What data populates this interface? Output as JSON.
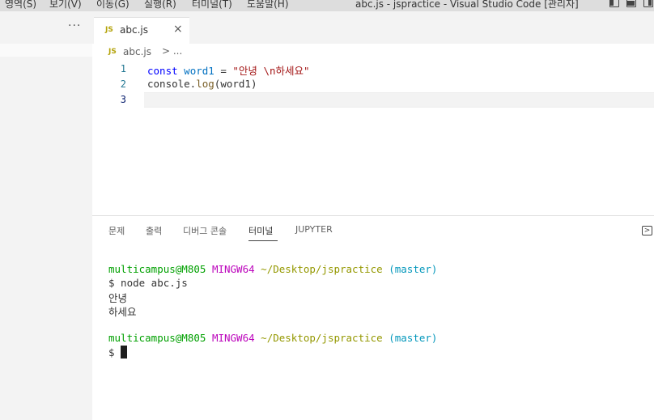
{
  "menu": {
    "items": [
      "영역(S)",
      "보기(V)",
      "이동(G)",
      "실행(R)",
      "터미널(T)",
      "도움말(H)"
    ],
    "window_title": "abc.js - jspractice - Visual Studio Code [관리자]"
  },
  "sidebar": {
    "more_label": "···"
  },
  "editor_tab": {
    "badge": "JS",
    "label": "abc.js",
    "close": "×"
  },
  "breadcrumb": {
    "badge": "JS",
    "file": "abc.js",
    "sep": "> ..."
  },
  "code": {
    "line_numbers": [
      "1",
      "2",
      "3"
    ],
    "line1": {
      "kw": "const",
      "var": "word1",
      "op": " = ",
      "str": "\"안녕 \\n하세요\""
    },
    "line2": {
      "obj": "console.",
      "fn": "log",
      "args": "(word1)"
    }
  },
  "panel": {
    "tabs": [
      "문제",
      "출력",
      "디버그 콘솔",
      "터미널",
      "JUPYTER"
    ],
    "active_tab": "터미널",
    "toggle_icon": ">"
  },
  "terminal": {
    "prompt_user": "multicampus@M805",
    "prompt_env": "MINGW64",
    "prompt_path": "~/Desktop/jspractice",
    "prompt_branch": "(master)",
    "command": "$ node abc.js",
    "output1": "안녕",
    "output2": "하세요",
    "dollar": "$"
  },
  "colors": {
    "user": "#00a000",
    "env": "#bc05bc",
    "path": "#949800",
    "branch": "#0598bc"
  }
}
